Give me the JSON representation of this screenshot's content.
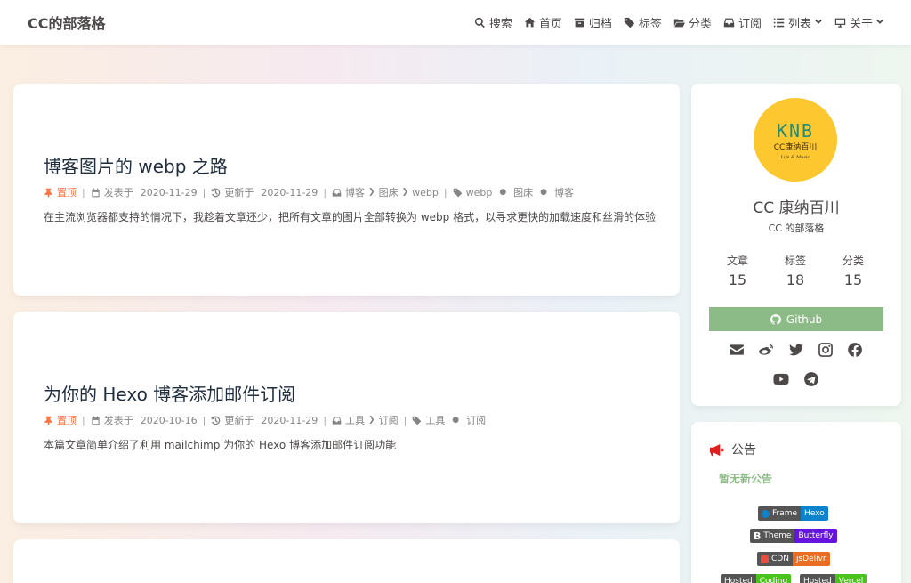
{
  "nav": {
    "site_name": "CC的部落格",
    "menu": [
      {
        "label": "搜索",
        "icon": "search-icon"
      },
      {
        "label": "首页",
        "icon": "home-icon"
      },
      {
        "label": "归档",
        "icon": "archive-icon"
      },
      {
        "label": "标签",
        "icon": "tags-icon"
      },
      {
        "label": "分类",
        "icon": "folder-open-icon"
      },
      {
        "label": "订阅",
        "icon": "inbox-icon"
      },
      {
        "label": "列表",
        "icon": "list-icon"
      },
      {
        "label": "关于",
        "icon": "desktop-icon"
      }
    ]
  },
  "posts": [
    {
      "title": "博客图片的 webp 之路",
      "sticky": "置顶",
      "posted_label": "发表于",
      "posted_date": "2020-11-29",
      "updated_label": "更新于",
      "updated_date": "2020-11-29",
      "categories": [
        "博客",
        "图床",
        "webp"
      ],
      "tags": [
        "webp",
        "图床",
        "博客"
      ],
      "excerpt": "在主流浏览器都支持的情况下，我趁着文章还少，把所有文章的图片全部转换为 webp 格式，以寻求更快的加载速度和丝滑的体验"
    },
    {
      "title": "为你的 Hexo 博客添加邮件订阅",
      "sticky": "置顶",
      "posted_label": "发表于",
      "posted_date": "2020-10-16",
      "updated_label": "更新于",
      "updated_date": "2020-11-29",
      "categories": [
        "工具",
        "订阅"
      ],
      "tags": [
        "工具",
        "订阅"
      ],
      "excerpt": "本篇文章简单介绍了利用 mailchimp 为你的 Hexo 博客添加邮件订阅功能"
    }
  ],
  "author": {
    "avatar_logo": "KNB",
    "avatar_sub": "CC康纳百川",
    "avatar_motto": "Life & Music",
    "name": "CC 康纳百川",
    "description": "CC 的部落格",
    "stats": [
      {
        "label": "文章",
        "value": "15"
      },
      {
        "label": "标签",
        "value": "18"
      },
      {
        "label": "分类",
        "value": "15"
      }
    ],
    "github_label": "Github",
    "socials": [
      "envelope-icon",
      "weibo-icon",
      "twitter-icon",
      "instagram-icon",
      "facebook-icon",
      "youtube-icon",
      "telegram-icon"
    ]
  },
  "announcement": {
    "title": "公告",
    "body": "暂无新公告",
    "badges": [
      {
        "left": "Frame",
        "right": "Hexo",
        "color": "#0e83cd"
      },
      {
        "left": "Theme",
        "right": "Butterfly",
        "color": "#6513df"
      },
      {
        "left": "CDN",
        "right": "jsDelivr",
        "color": "#e96d23"
      },
      {
        "left": "Hosted",
        "right": "Coding",
        "color": "#4ac41c"
      },
      {
        "left": "Hosted",
        "right": "Vercel",
        "color": "#4ac41c"
      }
    ]
  },
  "colors": {
    "accent": "#8dbb87",
    "sticky": "#ff7242",
    "avatar_bg": "#fcc72f",
    "announce_icon": "#e01e1e"
  }
}
